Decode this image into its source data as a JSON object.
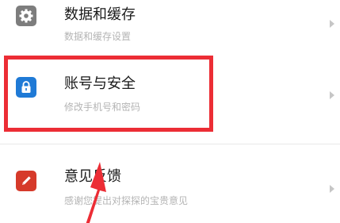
{
  "colors": {
    "accent_highlight": "#ec2d35",
    "icon_data": "#7d7d7d",
    "icon_security": "#1f7ad6",
    "icon_feedback": "#d63a2a",
    "title_text": "#1a1a1a",
    "subtitle_text": "#b4b4b4"
  },
  "settings": {
    "items": [
      {
        "title": "数据和缓存",
        "subtitle": "数据和缓存设置",
        "icon": "gear-icon"
      },
      {
        "title": "账号与安全",
        "subtitle": "修改手机号和密码",
        "icon": "lock-icon"
      },
      {
        "title": "意见反馈",
        "subtitle": "感谢您提出对探探的宝贵意见",
        "icon": "pencil-icon"
      }
    ]
  },
  "annotation": {
    "type": "highlight-box-with-arrow",
    "target": "账号与安全"
  }
}
